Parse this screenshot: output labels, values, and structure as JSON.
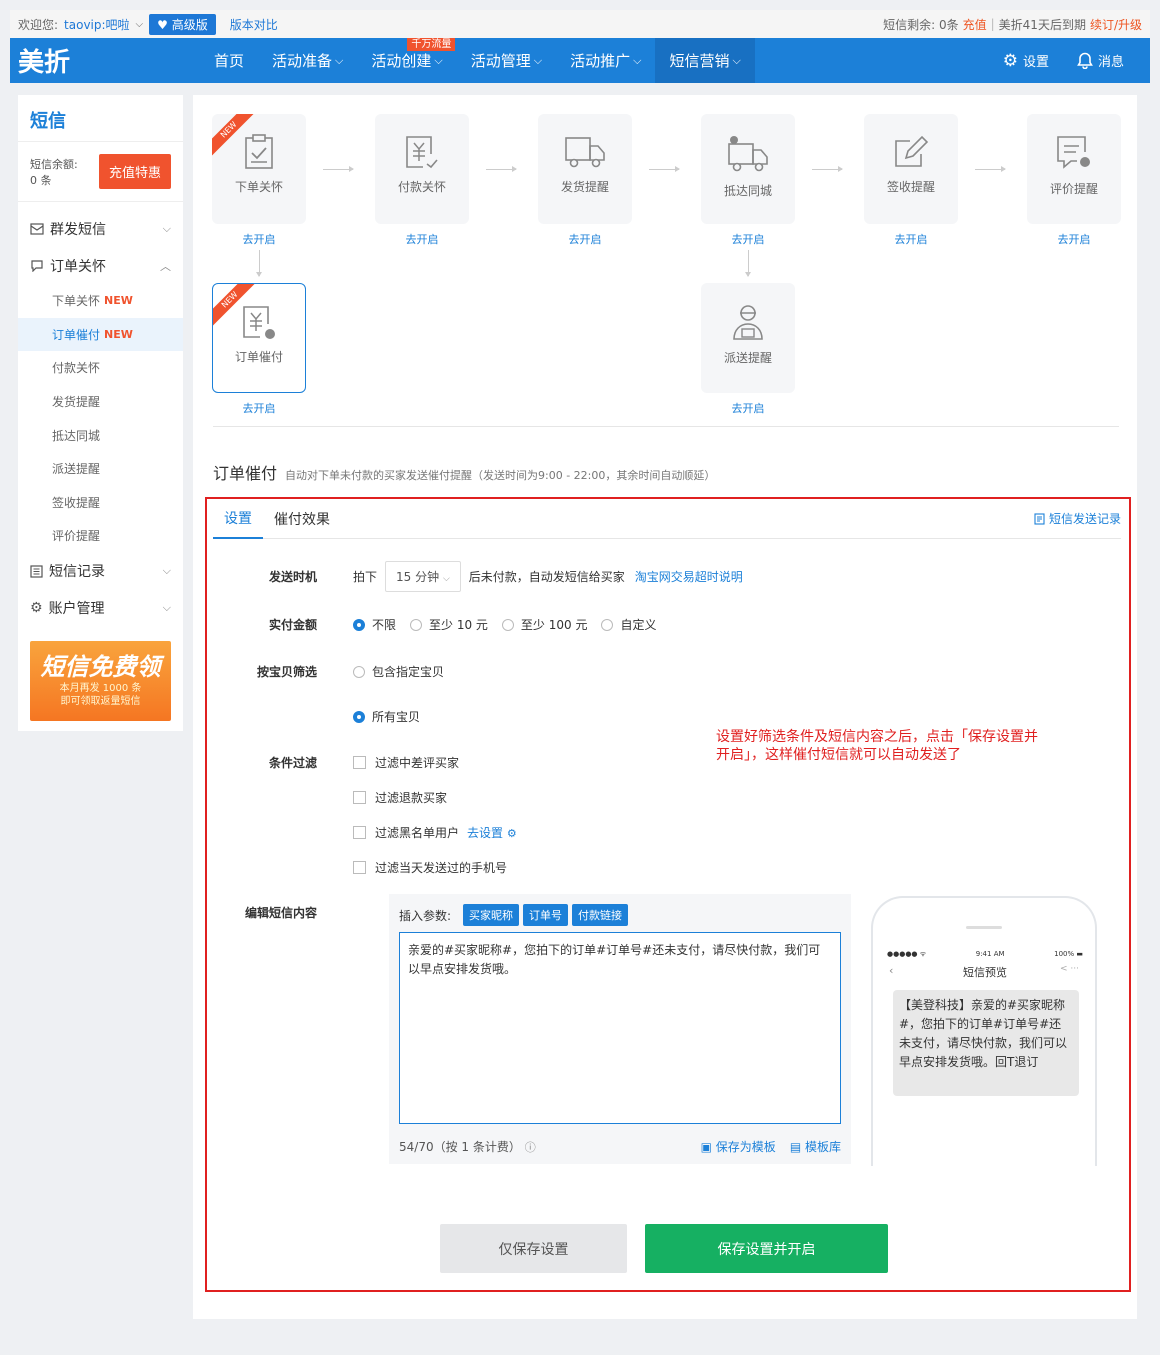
{
  "topbar": {
    "welcome": "欢迎您:",
    "user": "taovip:吧啦",
    "vip_label": "高级版",
    "compare": "版本对比",
    "sms_left": "短信剩余: 0条",
    "recharge": "充值",
    "expire": "美折41天后到期",
    "renew": "续订/升级"
  },
  "nav": {
    "logo": "美折",
    "items": [
      {
        "label": "首页"
      },
      {
        "label": "活动准备"
      },
      {
        "label": "活动创建",
        "badge": "千万流量"
      },
      {
        "label": "活动管理"
      },
      {
        "label": "活动推广"
      },
      {
        "label": "短信营销"
      }
    ],
    "settings": "设置",
    "messages": "消息"
  },
  "sidebar": {
    "title": "短信",
    "balance_label": "短信余额:",
    "balance_value": "0 条",
    "recharge_btn": "充值特惠",
    "groups": [
      {
        "label": "群发短信"
      },
      {
        "label": "订单关怀"
      },
      {
        "label": "短信记录"
      },
      {
        "label": "账户管理"
      }
    ],
    "subs": [
      {
        "label": "下单关怀",
        "new": "NEW"
      },
      {
        "label": "订单催付",
        "new": "NEW"
      },
      {
        "label": "付款关怀"
      },
      {
        "label": "发货提醒"
      },
      {
        "label": "抵达同城"
      },
      {
        "label": "派送提醒"
      },
      {
        "label": "签收提醒"
      },
      {
        "label": "评价提醒"
      }
    ],
    "banner": {
      "title": "短信免费领",
      "line1": "本月再发 1000 条",
      "line2": "即可领取返量短信"
    }
  },
  "flow": {
    "ribbon": "NEW",
    "cards": [
      {
        "label": "下单关怀",
        "open": "去开启"
      },
      {
        "label": "付款关怀",
        "open": "去开启"
      },
      {
        "label": "发货提醒",
        "open": "去开启"
      },
      {
        "label": "抵达同城",
        "open": "去开启"
      },
      {
        "label": "签收提醒",
        "open": "去开启"
      },
      {
        "label": "评价提醒",
        "open": "去开启"
      },
      {
        "label": "订单催付",
        "open": "去开启"
      },
      {
        "label": "派送提醒",
        "open": "去开启"
      }
    ]
  },
  "section": {
    "title": "订单催付",
    "desc": "自动对下单未付款的买家发送催付提醒（发送时间为9:00 - 22:00，其余时间自动顺延）"
  },
  "tabs": {
    "settings": "设置",
    "effect": "催付效果",
    "record": "短信发送记录"
  },
  "form": {
    "send_time": {
      "label": "发送时机",
      "prefix": "拍下",
      "value": "15 分钟",
      "suffix": "后未付款，自动发短信给买家",
      "link": "淘宝网交易超时说明"
    },
    "amount": {
      "label": "实付金额",
      "options": [
        "不限",
        "至少 10 元",
        "至少 100 元",
        "自定义"
      ]
    },
    "item_filter": {
      "label": "按宝贝筛选",
      "opt1": "包含指定宝贝",
      "opt2": "所有宝贝"
    },
    "cond": {
      "label": "条件过滤",
      "items": [
        "过滤中差评买家",
        "过滤退款买家",
        "过滤黑名单用户",
        "过滤当天发送过的手机号"
      ],
      "blacklist_link": "去设置"
    },
    "content": {
      "label": "编辑短信内容",
      "insert_label": "插入参数:",
      "params": [
        "买家昵称",
        "订单号",
        "付款链接"
      ],
      "text": "亲爱的#买家昵称#，您拍下的订单#订单号#还未支付，请尽快付款，我们可以早点安排发货哦。",
      "count": "54/70（按 1 条计费）",
      "save_tpl": "保存为模板",
      "tpl_lib": "模板库"
    },
    "note": "设置好筛选条件及短信内容之后，点击「保存设置并开启」，这样催付短信就可以自动发送了"
  },
  "phone": {
    "carrier": "●●●●● ᯤ",
    "time": "9:41 AM",
    "battery": "100% ▬",
    "title": "短信预览",
    "message": "【美登科技】亲爱的#买家昵称#，您拍下的订单#订单号#还未支付，请尽快付款，我们可以早点安排发货哦。回T退订"
  },
  "buttons": {
    "save_only": "仅保存设置",
    "save_open": "保存设置并开启"
  },
  "colors": {
    "primary": "#1c80d8",
    "accent": "#f0532e",
    "success": "#16b062",
    "highlight": "#e02020"
  }
}
